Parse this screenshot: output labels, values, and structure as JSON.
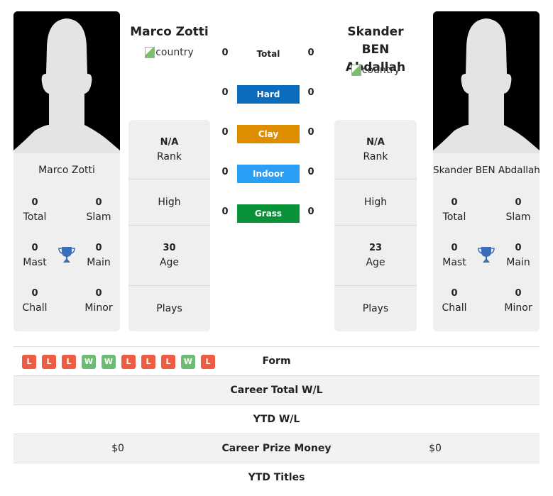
{
  "player1": {
    "name": "Marco Zotti",
    "country_alt": "country",
    "stats": {
      "total": {
        "value": "0",
        "label": "Total"
      },
      "slam": {
        "value": "0",
        "label": "Slam"
      },
      "mast": {
        "value": "0",
        "label": "Mast"
      },
      "main": {
        "value": "0",
        "label": "Main"
      },
      "chall": {
        "value": "0",
        "label": "Chall"
      },
      "minor": {
        "value": "0",
        "label": "Minor"
      }
    },
    "info": {
      "rank": {
        "value": "N/A",
        "label": "Rank"
      },
      "high": {
        "label": "High"
      },
      "age": {
        "value": "30",
        "label": "Age"
      },
      "plays": {
        "label": "Plays"
      }
    }
  },
  "player2": {
    "name": "Skander BEN Abdallah",
    "country_alt": "country",
    "stats": {
      "total": {
        "value": "0",
        "label": "Total"
      },
      "slam": {
        "value": "0",
        "label": "Slam"
      },
      "mast": {
        "value": "0",
        "label": "Mast"
      },
      "main": {
        "value": "0",
        "label": "Main"
      },
      "chall": {
        "value": "0",
        "label": "Chall"
      },
      "minor": {
        "value": "0",
        "label": "Minor"
      }
    },
    "info": {
      "rank": {
        "value": "N/A",
        "label": "Rank"
      },
      "high": {
        "label": "High"
      },
      "age": {
        "value": "23",
        "label": "Age"
      },
      "plays": {
        "label": "Plays"
      }
    }
  },
  "surfaces": [
    {
      "label": "Total",
      "p1": "0",
      "p2": "0",
      "color": null
    },
    {
      "label": "Hard",
      "p1": "0",
      "p2": "0",
      "color": "#0a6cbf"
    },
    {
      "label": "Clay",
      "p1": "0",
      "p2": "0",
      "color": "#de8c00"
    },
    {
      "label": "Indoor",
      "p1": "0",
      "p2": "0",
      "color": "#2b9ff5"
    },
    {
      "label": "Grass",
      "p1": "0",
      "p2": "0",
      "color": "#0a9238"
    }
  ],
  "comparison": {
    "form": {
      "label": "Form",
      "p1": [
        "L",
        "L",
        "L",
        "W",
        "W",
        "L",
        "L",
        "L",
        "W",
        "L"
      ]
    },
    "career_wl": {
      "label": "Career Total W/L",
      "p1": "",
      "p2": ""
    },
    "ytd_wl": {
      "label": "YTD W/L",
      "p1": "",
      "p2": ""
    },
    "prize": {
      "label": "Career Prize Money",
      "p1": "$0",
      "p2": "$0"
    },
    "ytd_titles": {
      "label": "YTD Titles",
      "p1": "",
      "p2": ""
    }
  },
  "colors": {
    "win": "#6cbc73",
    "loss": "#ee5c44",
    "trophy": "#3a6fb8"
  }
}
